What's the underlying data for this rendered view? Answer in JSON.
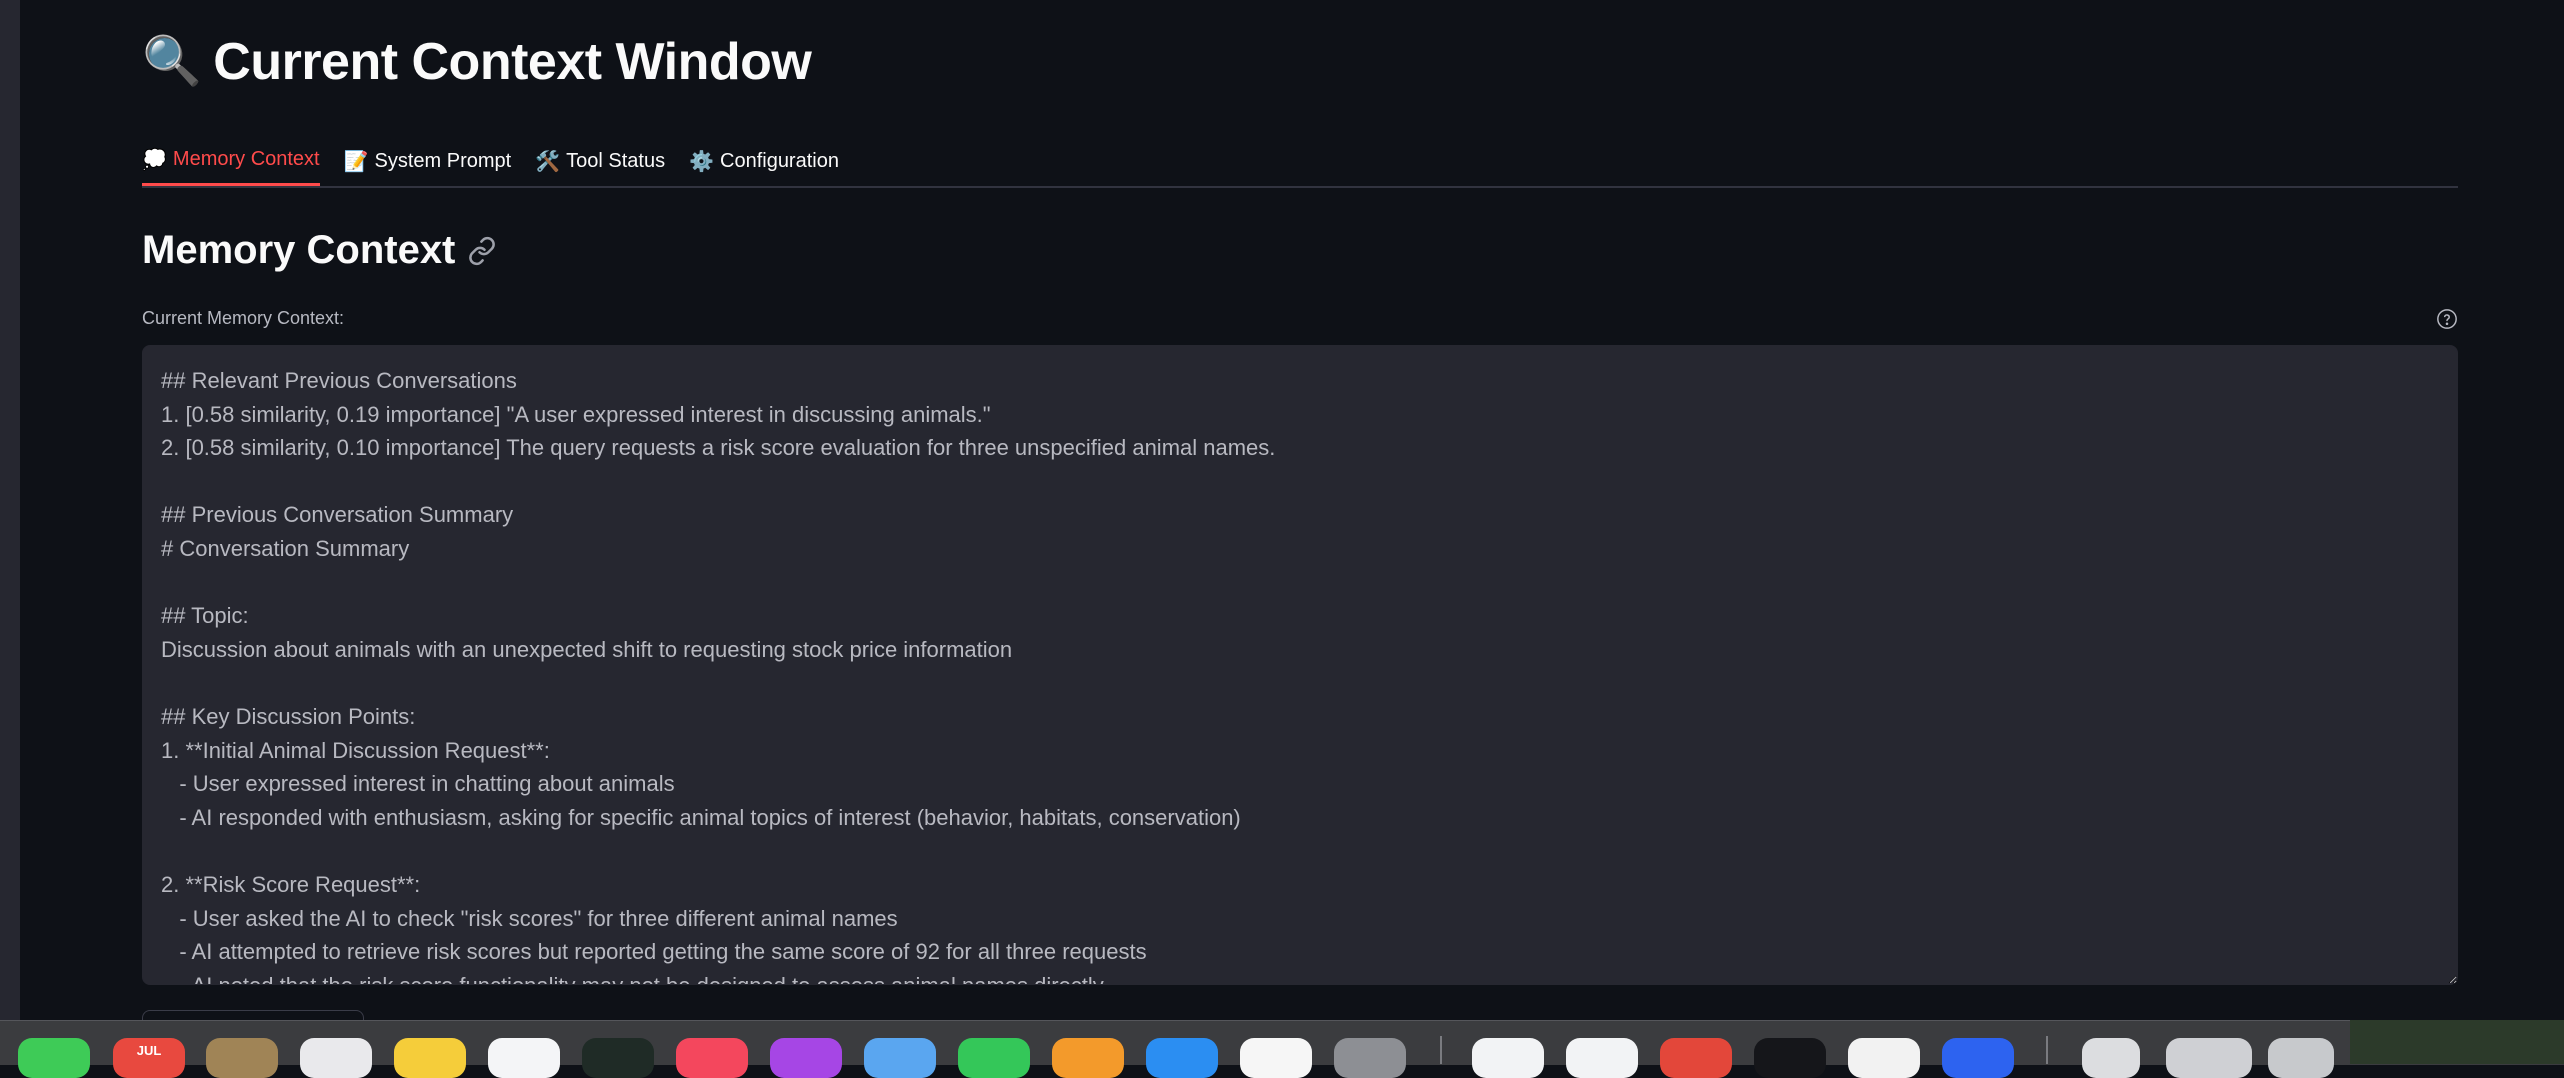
{
  "page": {
    "title_icon": "🔍",
    "title": "Current Context Window"
  },
  "tabs": [
    {
      "icon": "💭",
      "label": "Memory Context",
      "active": true
    },
    {
      "icon": "📝",
      "label": "System Prompt",
      "active": false
    },
    {
      "icon": "🛠️",
      "label": "Tool Status",
      "active": false
    },
    {
      "icon": "⚙️",
      "label": "Configuration",
      "active": false
    }
  ],
  "section": {
    "heading": "Memory Context",
    "field_label": "Current Memory Context:"
  },
  "memory_context_value": "## Relevant Previous Conversations\n1. [0.58 similarity, 0.19 importance] \"A user expressed interest in discussing animals.\"\n2. [0.58 similarity, 0.10 importance] The query requests a risk score evaluation for three unspecified animal names.\n\n## Previous Conversation Summary\n# Conversation Summary\n\n## Topic:\nDiscussion about animals with an unexpected shift to requesting stock price information\n\n## Key Discussion Points:\n1. **Initial Animal Discussion Request**:\n   - User expressed interest in chatting about animals\n   - AI responded with enthusiasm, asking for specific animal topics of interest (behavior, habitats, conservation)\n\n2. **Risk Score Request**:\n   - User asked the AI to check \"risk scores\" for three different animal names\n   - AI attempted to retrieve risk scores but reported getting the same score of 92 for all three requests\n   - AI noted that the risk score functionality may not be designed to assess animal names directly",
  "dock": {
    "calendar_month": "JUL"
  },
  "colors": {
    "background": "#0e1117",
    "accent": "#ff4b4b",
    "textarea_bg": "#262730"
  }
}
